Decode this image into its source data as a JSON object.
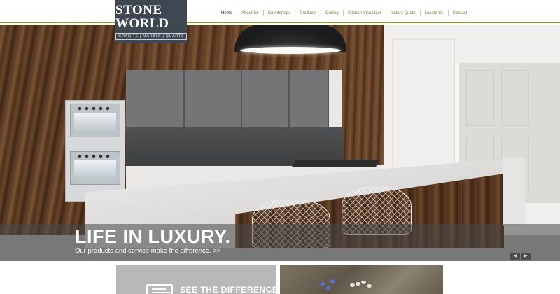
{
  "brand": {
    "name_first": "STONE",
    "name_second": "WORLD",
    "tagline": "GRANITE | MARBLE | QUARTZ"
  },
  "nav": {
    "items": [
      {
        "label": "Home",
        "active": true
      },
      {
        "label": "About Us",
        "active": false
      },
      {
        "label": "Countertops",
        "active": false
      },
      {
        "label": "Products",
        "active": false
      },
      {
        "label": "Gallery",
        "active": false
      },
      {
        "label": "Kitchen Visualizer",
        "active": false
      },
      {
        "label": "Instant Quote",
        "active": false
      },
      {
        "label": "Locate Us",
        "active": false
      },
      {
        "label": "Contact",
        "active": false
      }
    ]
  },
  "hero": {
    "title": "LIFE IN LUXURY.",
    "subtitle": "Our products and service make the difference. >>",
    "prev_icon": "chevron-left-icon",
    "next_icon": "chevron-right-icon"
  },
  "tiles": {
    "difference_label": "SEE THE DIFFERENCE",
    "difference_icon": "document-icon"
  },
  "colors": {
    "accent_green": "#7aa43a",
    "logo_bg": "#3f4852",
    "nav_text": "#6d7c3a",
    "nav_active": "#2e2e2e"
  }
}
